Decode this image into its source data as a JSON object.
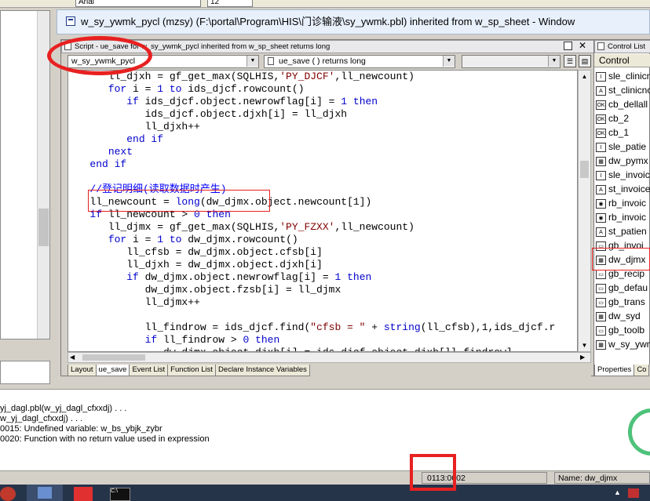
{
  "top_toolbar": {
    "font_name": "Arial",
    "font_size": "12"
  },
  "window": {
    "title": "w_sy_ywmk_pycl (mzsy) (F:\\portal\\Program\\HIS\\门诊输液\\sy_ywmk.pbl) inherited from w_sp_sheet - Window"
  },
  "script_pane": {
    "title": "Script - ue_save for w_sy_ywmk_pycl inherited from w_sp_sheet returns long",
    "object_combo": "w_sy_ywmk_pycl",
    "event_combo": "ue_save ( )  returns long",
    "third_combo": ""
  },
  "code_lines": [
    [
      {
        "t": "      ll_djxh = gf_get_max(SQLHIS,",
        "c": ""
      },
      {
        "t": "'PY_DJCF'",
        "c": "str"
      },
      {
        "t": ",ll_newcount)",
        "c": ""
      }
    ],
    [
      {
        "t": "      ",
        "c": ""
      },
      {
        "t": "for",
        "c": "kw"
      },
      {
        "t": " i = ",
        "c": ""
      },
      {
        "t": "1",
        "c": "kw"
      },
      {
        "t": " ",
        "c": ""
      },
      {
        "t": "to",
        "c": "kw"
      },
      {
        "t": " ids_djcf.rowcount()",
        "c": ""
      }
    ],
    [
      {
        "t": "         ",
        "c": ""
      },
      {
        "t": "if",
        "c": "kw"
      },
      {
        "t": " ids_djcf.object.newrowflag[i] = ",
        "c": ""
      },
      {
        "t": "1",
        "c": "kw"
      },
      {
        "t": " ",
        "c": ""
      },
      {
        "t": "then",
        "c": "kw"
      }
    ],
    [
      {
        "t": "            ids_djcf.object.djxh[i] = ll_djxh",
        "c": ""
      }
    ],
    [
      {
        "t": "            ll_djxh++",
        "c": ""
      }
    ],
    [
      {
        "t": "         ",
        "c": ""
      },
      {
        "t": "end if",
        "c": "kw"
      }
    ],
    [
      {
        "t": "      ",
        "c": ""
      },
      {
        "t": "next",
        "c": "kw"
      }
    ],
    [
      {
        "t": "   ",
        "c": ""
      },
      {
        "t": "end if",
        "c": "kw"
      }
    ],
    [
      {
        "t": "",
        "c": ""
      }
    ],
    [
      {
        "t": "   //登记明细(读取数据时产生)",
        "c": "cm"
      }
    ],
    [
      {
        "t": "   ll_newcount = ",
        "c": ""
      },
      {
        "t": "long",
        "c": "kw"
      },
      {
        "t": "(dw_djmx.object.newcount[1])",
        "c": ""
      }
    ],
    [
      {
        "t": "   ",
        "c": ""
      },
      {
        "t": "if",
        "c": "kw"
      },
      {
        "t": " ll_newcount > ",
        "c": ""
      },
      {
        "t": "0",
        "c": "kw"
      },
      {
        "t": " ",
        "c": ""
      },
      {
        "t": "then",
        "c": "kw"
      }
    ],
    [
      {
        "t": "      ll_djmx = gf_get_max(SQLHIS,",
        "c": ""
      },
      {
        "t": "'PY_FZXX'",
        "c": "str"
      },
      {
        "t": ",ll_newcount)",
        "c": ""
      }
    ],
    [
      {
        "t": "      ",
        "c": ""
      },
      {
        "t": "for",
        "c": "kw"
      },
      {
        "t": " i = ",
        "c": ""
      },
      {
        "t": "1",
        "c": "kw"
      },
      {
        "t": " ",
        "c": ""
      },
      {
        "t": "to",
        "c": "kw"
      },
      {
        "t": " dw_djmx.rowcount()",
        "c": ""
      }
    ],
    [
      {
        "t": "         ll_cfsb = dw_djmx.object.cfsb[i]",
        "c": ""
      }
    ],
    [
      {
        "t": "         ll_djxh = dw_djmx.object.djxh[i]",
        "c": ""
      }
    ],
    [
      {
        "t": "         ",
        "c": ""
      },
      {
        "t": "if",
        "c": "kw"
      },
      {
        "t": " dw_djmx.object.newrowflag[i] = ",
        "c": ""
      },
      {
        "t": "1",
        "c": "kw"
      },
      {
        "t": " ",
        "c": ""
      },
      {
        "t": "then",
        "c": "kw"
      }
    ],
    [
      {
        "t": "            dw_djmx.object.fzsb[i] = ll_djmx",
        "c": ""
      }
    ],
    [
      {
        "t": "            ll_djmx++",
        "c": ""
      }
    ],
    [
      {
        "t": "",
        "c": ""
      }
    ],
    [
      {
        "t": "            ll_findrow = ids_djcf.find(",
        "c": ""
      },
      {
        "t": "\"cfsb = \"",
        "c": "str"
      },
      {
        "t": " + ",
        "c": ""
      },
      {
        "t": "string",
        "c": "kw"
      },
      {
        "t": "(ll_cfsb),1,ids_djcf.r",
        "c": ""
      }
    ],
    [
      {
        "t": "            ",
        "c": ""
      },
      {
        "t": "if",
        "c": "kw"
      },
      {
        "t": " ll_findrow > ",
        "c": ""
      },
      {
        "t": "0",
        "c": "kw"
      },
      {
        "t": " ",
        "c": ""
      },
      {
        "t": "then",
        "c": "kw"
      }
    ],
    [
      {
        "t": "               dw_djmx.object.djxh[i] = ids_djcf.object.djxh[ll_findrow]",
        "c": ""
      }
    ]
  ],
  "bottom_tabs": [
    "Layout",
    "ue_save",
    "Event List",
    "Function List",
    "Declare Instance Variables"
  ],
  "control_list": {
    "title": "Control List",
    "header": "Control",
    "items": [
      {
        "icon": "I",
        "label": "sle_clinicn"
      },
      {
        "icon": "A",
        "label": "st_clinicno"
      },
      {
        "icon": "OK",
        "label": "cb_dellall"
      },
      {
        "icon": "OK",
        "label": "cb_2"
      },
      {
        "icon": "OK",
        "label": "cb_1"
      },
      {
        "icon": "I",
        "label": "sle_patie"
      },
      {
        "icon": "▦",
        "label": "dw_pymx"
      },
      {
        "icon": "I",
        "label": "sle_invoic"
      },
      {
        "icon": "A",
        "label": "st_invoice"
      },
      {
        "icon": "◉",
        "label": "rb_invoic"
      },
      {
        "icon": "◉",
        "label": "rb_invoic"
      },
      {
        "icon": "A",
        "label": "st_patien"
      },
      {
        "icon": "▭",
        "label": "gb_invoi"
      },
      {
        "icon": "▦",
        "label": "dw_djmx"
      },
      {
        "icon": "▭",
        "label": "gb_recip"
      },
      {
        "icon": "▭",
        "label": "gb_defau"
      },
      {
        "icon": "▭",
        "label": "gb_trans"
      },
      {
        "icon": "▦",
        "label": "dw_syd"
      },
      {
        "icon": "▭",
        "label": "gb_toolb"
      },
      {
        "icon": "▦",
        "label": "w_sy_ywm"
      }
    ],
    "tabs": [
      "Properties",
      "Co"
    ]
  },
  "output": {
    "lines": [
      "yj_dagl.pbl(w_yj_dagl_cfxxdj) . . .",
      "w_yj_dagl_cfxxdj) . . .",
      "0015: Undefined variable: w_bs_ybjk_zybr",
      "0020: Function with no return value used in expression"
    ]
  },
  "status": {
    "position": "0113:0002",
    "name": "Name: dw_djmx"
  },
  "colors": {
    "annotation_red": "#e82020",
    "keyword_blue": "#0000cc",
    "string_maroon": "#800000"
  }
}
